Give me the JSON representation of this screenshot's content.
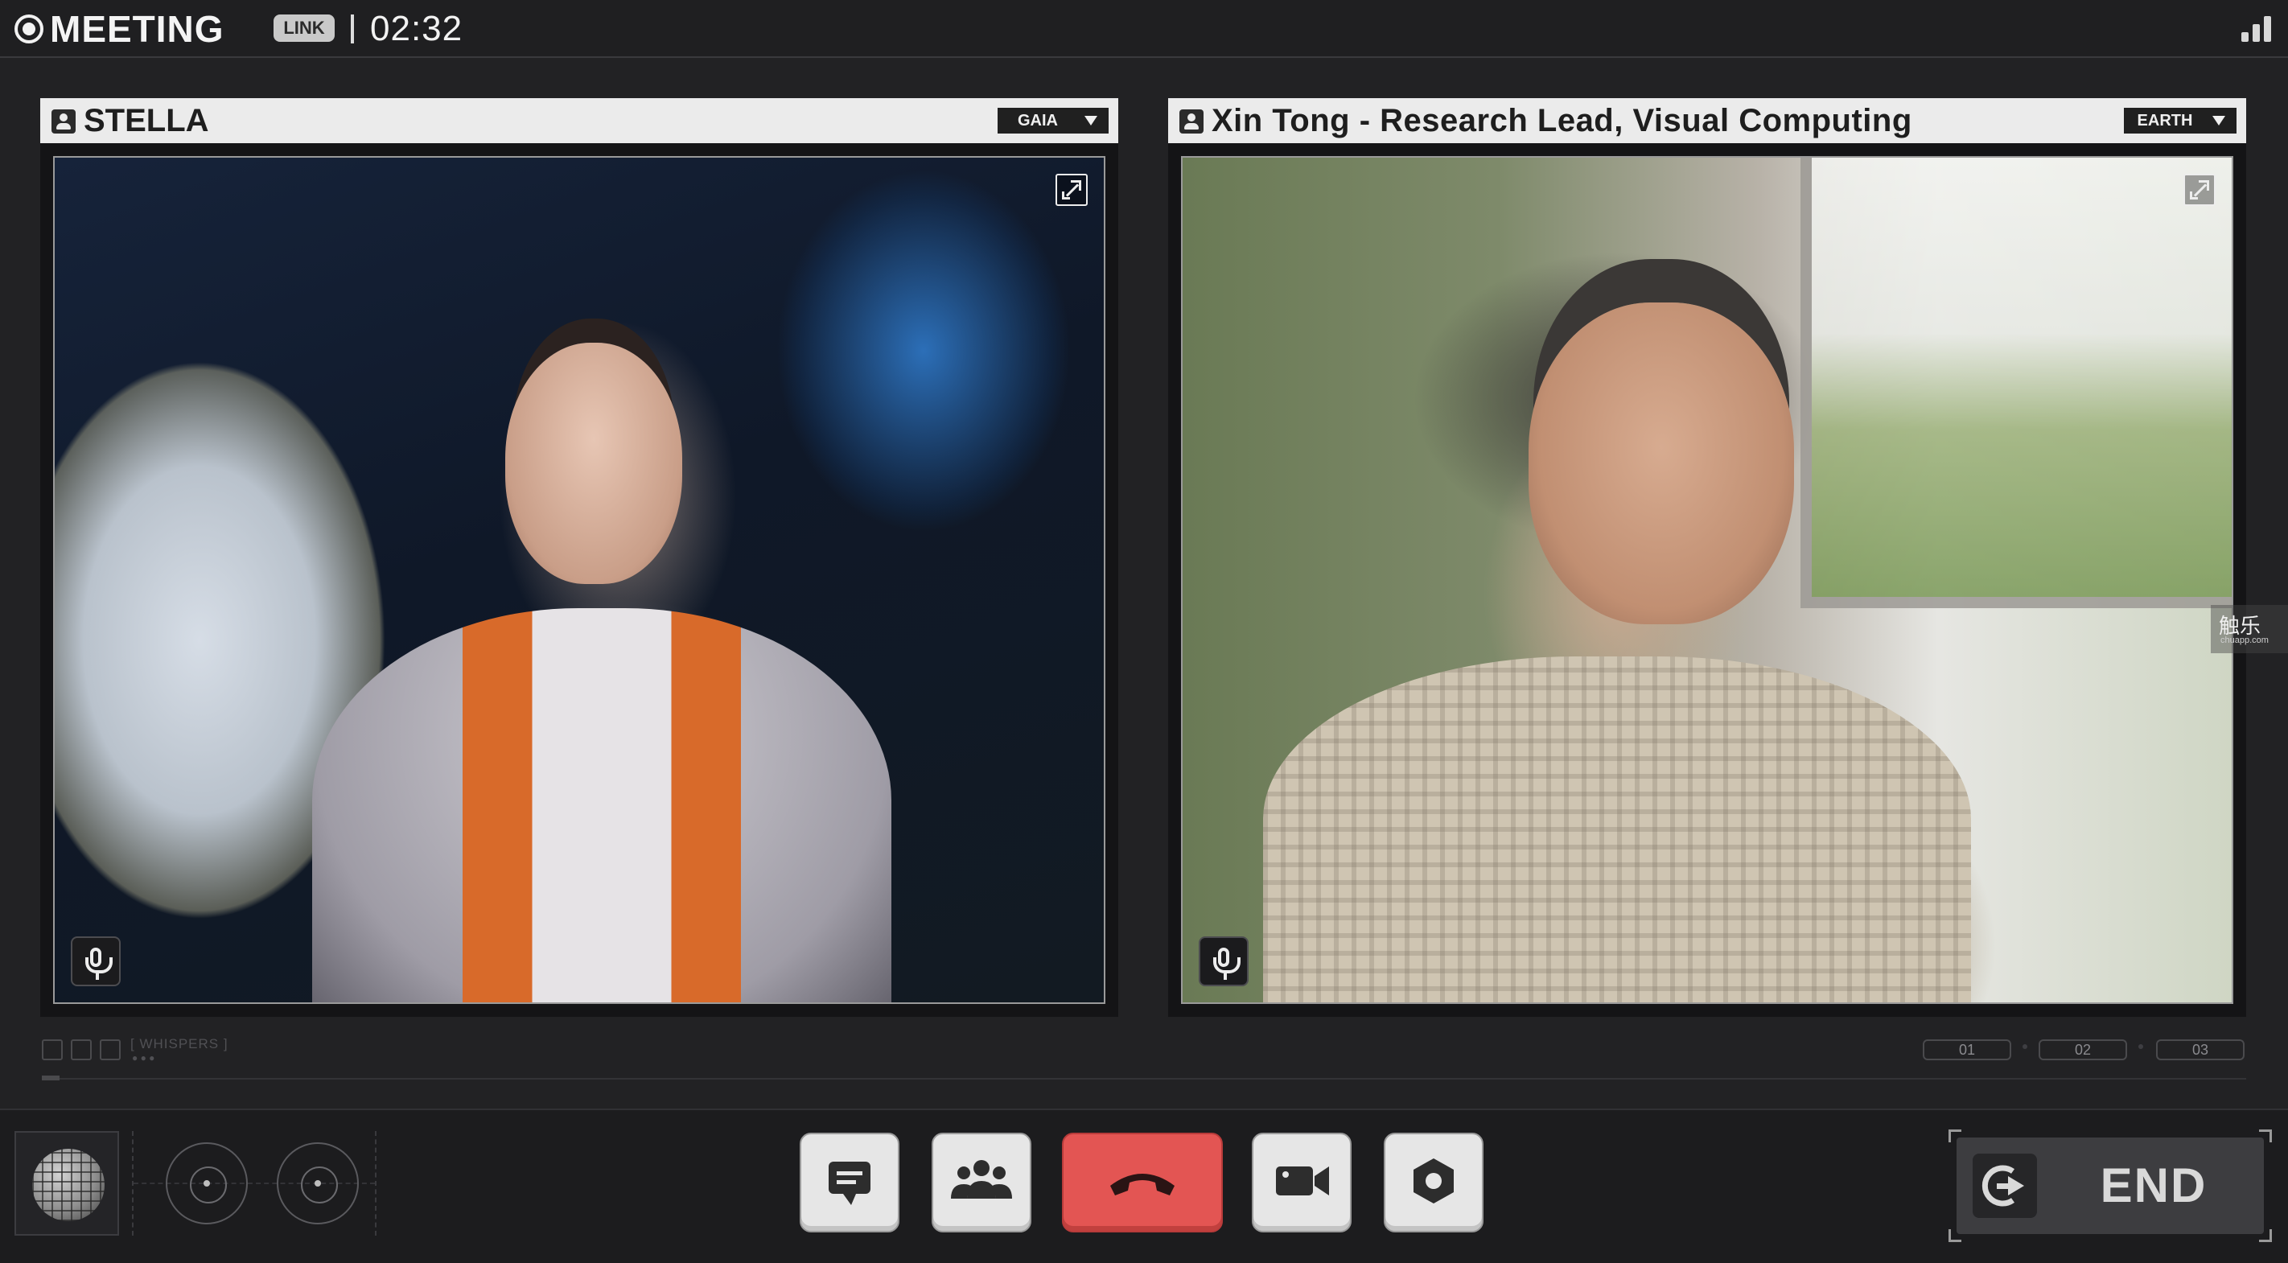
{
  "header": {
    "app_title": "MEETING",
    "badge": "LINK",
    "call_timer": "02:32"
  },
  "participants": [
    {
      "name": "STELLA",
      "location": "GAIA",
      "mic": "mic-icon",
      "expand": "expand-icon"
    },
    {
      "name": "Xin Tong - Research Lead, Visual Computing",
      "location": "EARTH",
      "mic": "mic-icon",
      "expand": "expand-icon"
    }
  ],
  "strip": {
    "label": "[ WHISPERS ]",
    "pages": [
      "01",
      "02",
      "03"
    ]
  },
  "watermark": {
    "main": "触乐",
    "sub": "chuapp.com"
  },
  "controls": {
    "buttons": [
      "chat-icon",
      "participants-icon",
      "hang-up-icon",
      "camera-icon",
      "settings-icon"
    ],
    "end_label": "END"
  },
  "colors": {
    "background": "#222224",
    "hangup": "#e35553",
    "control_button": "#e6e6e6",
    "panel_header": "#ebebeb"
  }
}
